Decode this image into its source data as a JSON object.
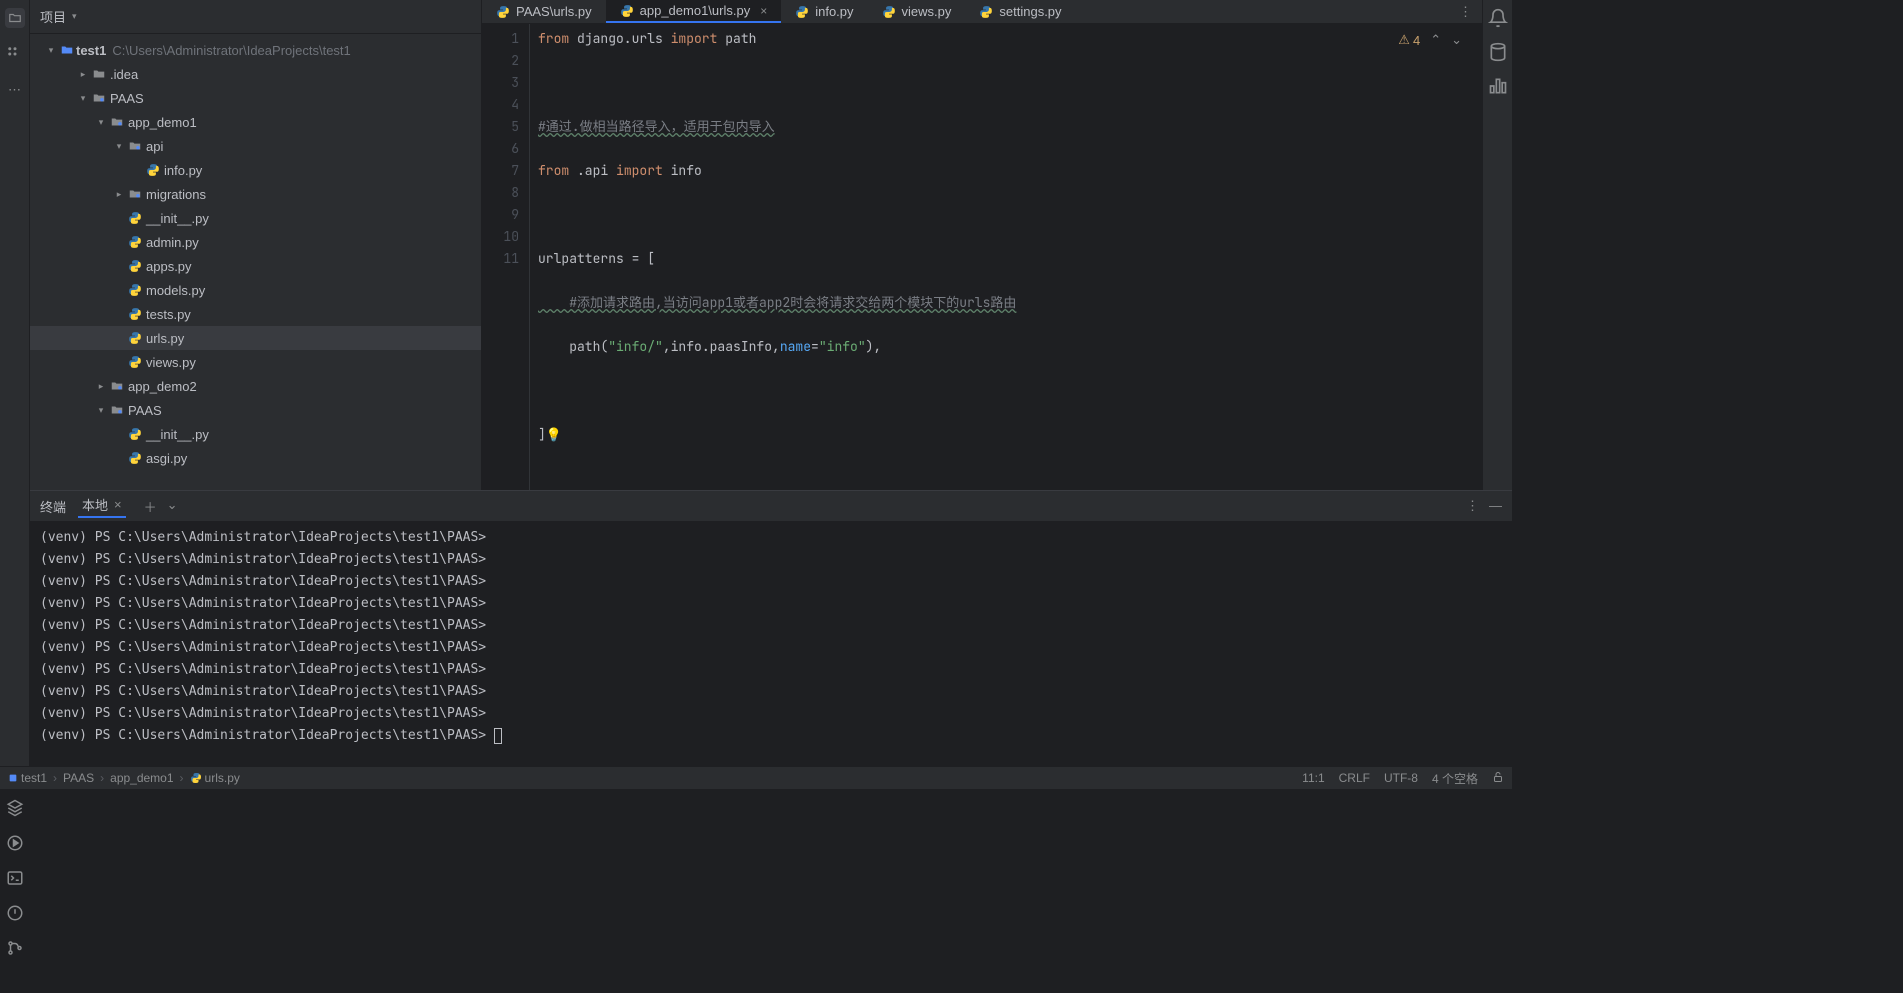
{
  "panel": {
    "title": "项目"
  },
  "tree": {
    "project_name": "test1",
    "project_path": "C:\\Users\\Administrator\\IdeaProjects\\test1",
    "items": [
      {
        "label": ".idea",
        "type": "folder",
        "indent": 1
      },
      {
        "label": "PAAS",
        "type": "folder-special",
        "indent": 1,
        "expanded": true
      },
      {
        "label": "app_demo1",
        "type": "folder-special",
        "indent": 2,
        "expanded": true
      },
      {
        "label": "api",
        "type": "folder-special",
        "indent": 3,
        "expanded": true
      },
      {
        "label": "info.py",
        "type": "py",
        "indent": 4
      },
      {
        "label": "migrations",
        "type": "folder-special",
        "indent": 3
      },
      {
        "label": "__init__.py",
        "type": "py",
        "indent": 3
      },
      {
        "label": "admin.py",
        "type": "py",
        "indent": 3
      },
      {
        "label": "apps.py",
        "type": "py",
        "indent": 3
      },
      {
        "label": "models.py",
        "type": "py",
        "indent": 3
      },
      {
        "label": "tests.py",
        "type": "py",
        "indent": 3
      },
      {
        "label": "urls.py",
        "type": "py",
        "indent": 3,
        "selected": true
      },
      {
        "label": "views.py",
        "type": "py",
        "indent": 3
      },
      {
        "label": "app_demo2",
        "type": "folder-special",
        "indent": 2
      },
      {
        "label": "PAAS",
        "type": "folder-special",
        "indent": 2,
        "expanded": true
      },
      {
        "label": "__init__.py",
        "type": "py",
        "indent": 3
      },
      {
        "label": "asgi.py",
        "type": "py",
        "indent": 3
      }
    ]
  },
  "tabs": [
    {
      "label": "PAAS\\urls.py",
      "active": false
    },
    {
      "label": "app_demo1\\urls.py",
      "active": true,
      "closeable": true
    },
    {
      "label": "info.py",
      "active": false
    },
    {
      "label": "views.py",
      "active": false
    },
    {
      "label": "settings.py",
      "active": false
    }
  ],
  "editor": {
    "warnings": "4",
    "lines": [
      "1",
      "2",
      "3",
      "4",
      "5",
      "6",
      "7",
      "8",
      "9",
      "10",
      "11"
    ],
    "code": {
      "l1_kw1": "from",
      "l1_mod": " django.urls ",
      "l1_kw2": "import",
      "l1_name": " path",
      "l3_cmt": "#通过.做相当路径导入，适用于包内导入",
      "l4_kw1": "from",
      "l4_mod": " .api ",
      "l4_kw2": "import",
      "l4_name": " info",
      "l6": "urlpatterns = [",
      "l7_cmt": "    #添加请求路由,当访问app1或者app2时会将请求交给两个模块下的urls路由",
      "l8_pre": "    path(",
      "l8_s1": "\"info/\"",
      "l8_mid": ",info.paasInfo,",
      "l8_param": "name",
      "l8_eq": "=",
      "l8_s2": "\"info\"",
      "l8_post": "),",
      "l10": "]"
    }
  },
  "terminal": {
    "title": "终端",
    "tab_label": "本地",
    "prompt": "(venv) PS C:\\Users\\Administrator\\IdeaProjects\\test1\\PAAS>",
    "line_count": 10
  },
  "breadcrumb": {
    "root": "test1",
    "parts": [
      "PAAS",
      "app_demo1"
    ],
    "file": "urls.py"
  },
  "status": {
    "cursor": "11:1",
    "linesep": "CRLF",
    "encoding": "UTF-8",
    "indent": "4 个空格"
  }
}
